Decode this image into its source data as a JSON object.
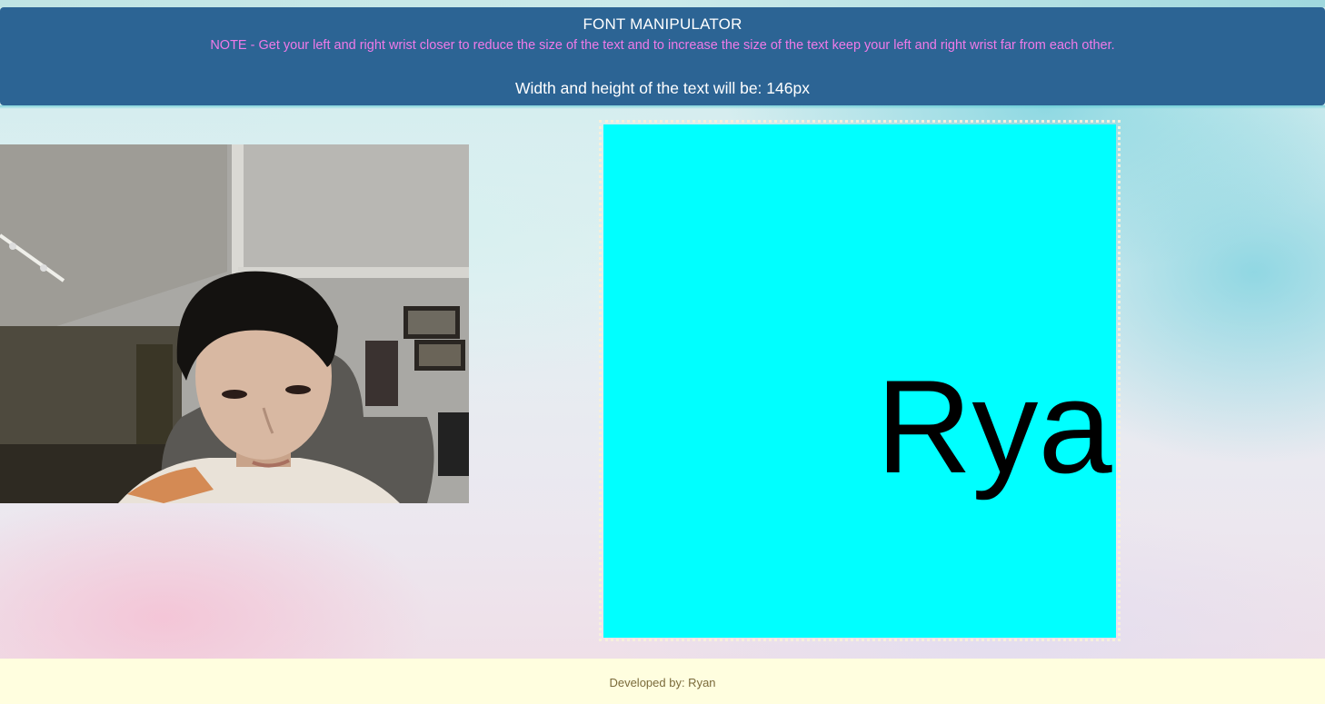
{
  "header": {
    "title": "FONT MANIPULATOR",
    "note": "NOTE - Get your left and right wrist closer to reduce the size of the text and to increase the size of the text keep your left and right wrist far from each other.",
    "size_text": "Width and height of the text will be: 146px"
  },
  "canvas": {
    "text": "Ryan",
    "background_color": "#00ffff",
    "text_color": "#000000",
    "font_size_value": 146
  },
  "webcam": {
    "icon": "webcam-feed-icon"
  },
  "footer": {
    "text": "Developed by: Ryan"
  },
  "colors": {
    "header_bg": "#2c6494",
    "note_color": "#f07ae8",
    "footer_bg": "#fffedf"
  }
}
